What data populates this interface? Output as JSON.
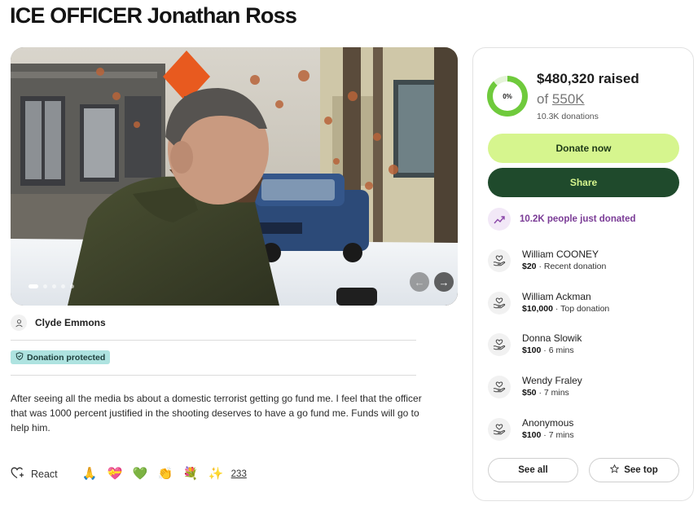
{
  "page": {
    "title": "ICE OFFICER Jonathan Ross"
  },
  "hero": {
    "alt": "Man in olive jacket with brown neck gaiter outside a house in snow",
    "slide_count": 5,
    "active_slide": 1
  },
  "organizer": {
    "name": "Clyde Emmons"
  },
  "badge": {
    "label": "Donation protected"
  },
  "description": "After seeing all the media bs about a domestic terrorist getting go fund me. I feel that the officer that was 1000 percent justified in the shooting deserves to have a go fund me. Funds will go to help him.",
  "reactions": {
    "react_label": "React",
    "emojis": [
      "🙏",
      "💝",
      "💚",
      "👏",
      "💐",
      "✨"
    ],
    "count": "233"
  },
  "donation_card": {
    "progress_label": "0%",
    "progress_fraction": 0.87,
    "raised": "$480,320 raised",
    "goal_prefix": "of",
    "goal_amount": "550K",
    "donations_count": "10.3K donations",
    "donate_label": "Donate now",
    "share_label": "Share",
    "trend_text": "10.2K people just donated",
    "donors": [
      {
        "name": "William COONEY",
        "amount": "$20",
        "note": " · Recent donation"
      },
      {
        "name": "William Ackman",
        "amount": "$10,000",
        "note": " · Top donation"
      },
      {
        "name": "Donna Slowik",
        "amount": "$100",
        "note": " · 6 mins"
      },
      {
        "name": "Wendy Fraley",
        "amount": "$50",
        "note": " · 7 mins"
      },
      {
        "name": "Anonymous",
        "amount": "$100",
        "note": " · 7 mins"
      }
    ],
    "see_all_label": "See all",
    "see_top_label": "See top"
  },
  "colors": {
    "accent_green": "#d6f58e",
    "share_dark_green": "#1f4a2c",
    "progress_green": "#6fca3c",
    "trend_purple": "#7a3b96",
    "badge_teal": "#aee3e0"
  },
  "icons": {
    "organizer": "person-icon",
    "badge": "shield-icon",
    "react": "heart-plus-icon",
    "trend": "trending-up-icon",
    "donor": "hand-heart-icon",
    "see_top": "star-icon",
    "carousel_prev": "arrow-left-icon",
    "carousel_next": "arrow-right-icon"
  }
}
